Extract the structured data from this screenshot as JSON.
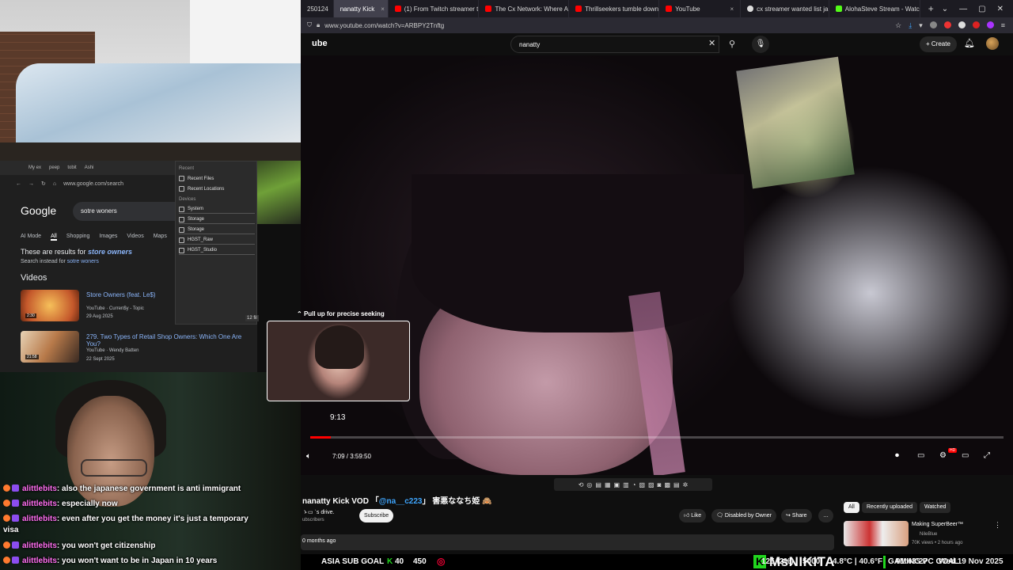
{
  "browser": {
    "tabs": [
      {
        "label": "250124",
        "color": "#444444",
        "active": false
      },
      {
        "label": "nanatty Kick",
        "color": "#53fc18",
        "active": true
      },
      {
        "label": "(1) From Twitch streamer t",
        "color": "#ff0000",
        "active": false
      },
      {
        "label": "The Cx Network: Where A",
        "color": "#ff0000",
        "active": false
      },
      {
        "label": "Thrillseekers tumble down",
        "color": "#ff0000",
        "active": false
      },
      {
        "label": "YouTube",
        "color": "#ff0000",
        "active": false
      },
      {
        "label": "cx streamer wanted list ja",
        "color": "#dddddd",
        "active": false
      },
      {
        "label": "AlohaSteve Stream - Watc",
        "color": "#53fc18",
        "active": false
      }
    ],
    "url": "www.youtube.com/watch?v=ARBPY2Tnftg"
  },
  "youtube": {
    "logo": "ube",
    "search_value": "nanatty",
    "create_label": "Create",
    "player": {
      "seek_hint": "Pull up for precise seeking",
      "preview_time": "9:13",
      "timecode": "7:09 / 3:59:50",
      "progress_fraction": 0.03,
      "hd_badge": "HD"
    },
    "video": {
      "title_prefix": "nanatty Kick VOD 「",
      "title_mention": "@na__c223",
      "title_suffix": "」 害悪ななち姫 🙈",
      "channel": "ゝ▭ ˈs ɗrive.",
      "subs": "ubscribers",
      "subscribe": "Subscribe",
      "like": "Like",
      "disabled": "Disabled by Owner",
      "share": "Share",
      "more": "…",
      "date": "0 months ago"
    },
    "chips": [
      "All",
      "Recently uploaded",
      "Watched"
    ],
    "recommendation": {
      "title": "Making SuperBeer™",
      "channel": "NileBlue",
      "meta": "70K views • 2 hours ago"
    }
  },
  "google": {
    "mini_tabs": [
      "My ex",
      "peep",
      "tobit",
      "Ashi"
    ],
    "mini_url": "www.google.com/search",
    "logo": "Google",
    "query": "sotre woners",
    "tabs": [
      "AI Mode",
      "All",
      "Shopping",
      "Images",
      "Videos",
      "Maps"
    ],
    "correction_prefix": "These are results for ",
    "correction_term": "store owners",
    "instead_prefix": "Search instead for ",
    "instead_term": "sotre woners",
    "videos_heading": "Videos",
    "videos": [
      {
        "title": "Store Owners (feat. Le$)",
        "source": "YouTube · Curren$y - Topic",
        "date": "29 Aug 2025",
        "duration": "2:30"
      },
      {
        "title": "279. Two Types of Retail Shop Owners: Which One Are You?",
        "source": "YouTube · Wendy Batten",
        "date": "22 Sept 2025",
        "duration": "21:58"
      }
    ]
  },
  "file_manager": {
    "recent_heading": "Recent",
    "recent": [
      "Recent Files",
      "Recent Locations"
    ],
    "devices_heading": "Devices",
    "devices": [
      "System",
      "Storage",
      "Storage",
      "HGST_Raw",
      "HGST_Studio"
    ],
    "size_label": "12 fil"
  },
  "chat": [
    {
      "user": "alittlebits",
      "message": "also the japanese government is anti immigrant"
    },
    {
      "user": "alittlebits",
      "message": "especially now"
    },
    {
      "user": "alittlebits",
      "message": "even after you get the money it's just a temporary visa"
    },
    {
      "user": "alittlebits",
      "message": "you won't get citizenship"
    },
    {
      "user": "alittlebits",
      "message": "you won't want to be in Japan in 10 years"
    }
  ],
  "ticker": {
    "sub_goal_label": "ASIA SUB GOAL",
    "sub_goal_current": "40",
    "sub_goal_target": "450",
    "brand": "MsNIKITA",
    "brand_k": "K",
    "pc_goal_label": "GAMING PC GOAL",
    "pc_goal_progress": "125 (2%)",
    "pc_goal_target": "5000",
    "temp": "4.8°C | 40.6°F",
    "time": "01:43:27",
    "date": "Wed 19 Nov 2025"
  }
}
